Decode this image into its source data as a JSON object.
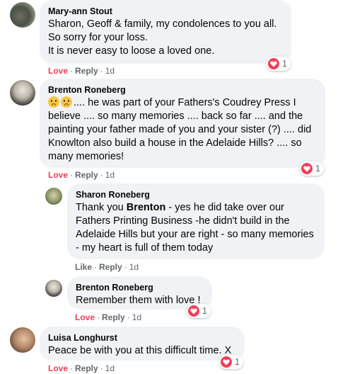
{
  "comments": [
    {
      "author": "Mary-ann Stout",
      "text": "Sharon, Geoff & family, my condolences to you all.\nSo sorry for your loss.\nIt is never easy to loose a loved one.",
      "love": "Love",
      "reply": "Reply",
      "time": "1d",
      "reaction_count": "1"
    },
    {
      "author": "Brenton Roneberg",
      "text": ".... he was part of your Fathers's Coudrey Press I believe .... so many memories .... back so far .... and the painting your father made of you and your sister (?) .... did Knowlton also build a house in the Adelaide Hills? .... so many memories!",
      "love": "Love",
      "reply": "Reply",
      "time": "1d",
      "reaction_count": "1"
    },
    {
      "author": "Sharon Roneberg",
      "text_before": "Thank you ",
      "mention": "Brenton",
      "text_after": " - yes he did take over our Fathers Printing Business -he didn't build in the Adelaide Hills but your are right - so many memories - my heart is full of them today",
      "like": "Like",
      "reply": "Reply",
      "time": "1d"
    },
    {
      "author": "Brenton Roneberg",
      "text": "Remember them with love !",
      "love": "Love",
      "reply": "Reply",
      "time": "1d",
      "reaction_count": "1"
    },
    {
      "author": "Luisa Longhurst",
      "text": "Peace be with you at this difficult time. X",
      "love": "Love",
      "reply": "Reply",
      "time": "1d",
      "reaction_count": "1"
    }
  ],
  "colors": {
    "bubble": "#f0f2f5",
    "love": "#f33e58",
    "meta": "#65676b"
  },
  "icons": {
    "reaction": "heart-reaction-icon",
    "emoji": "sad-face-emoji-icon"
  }
}
